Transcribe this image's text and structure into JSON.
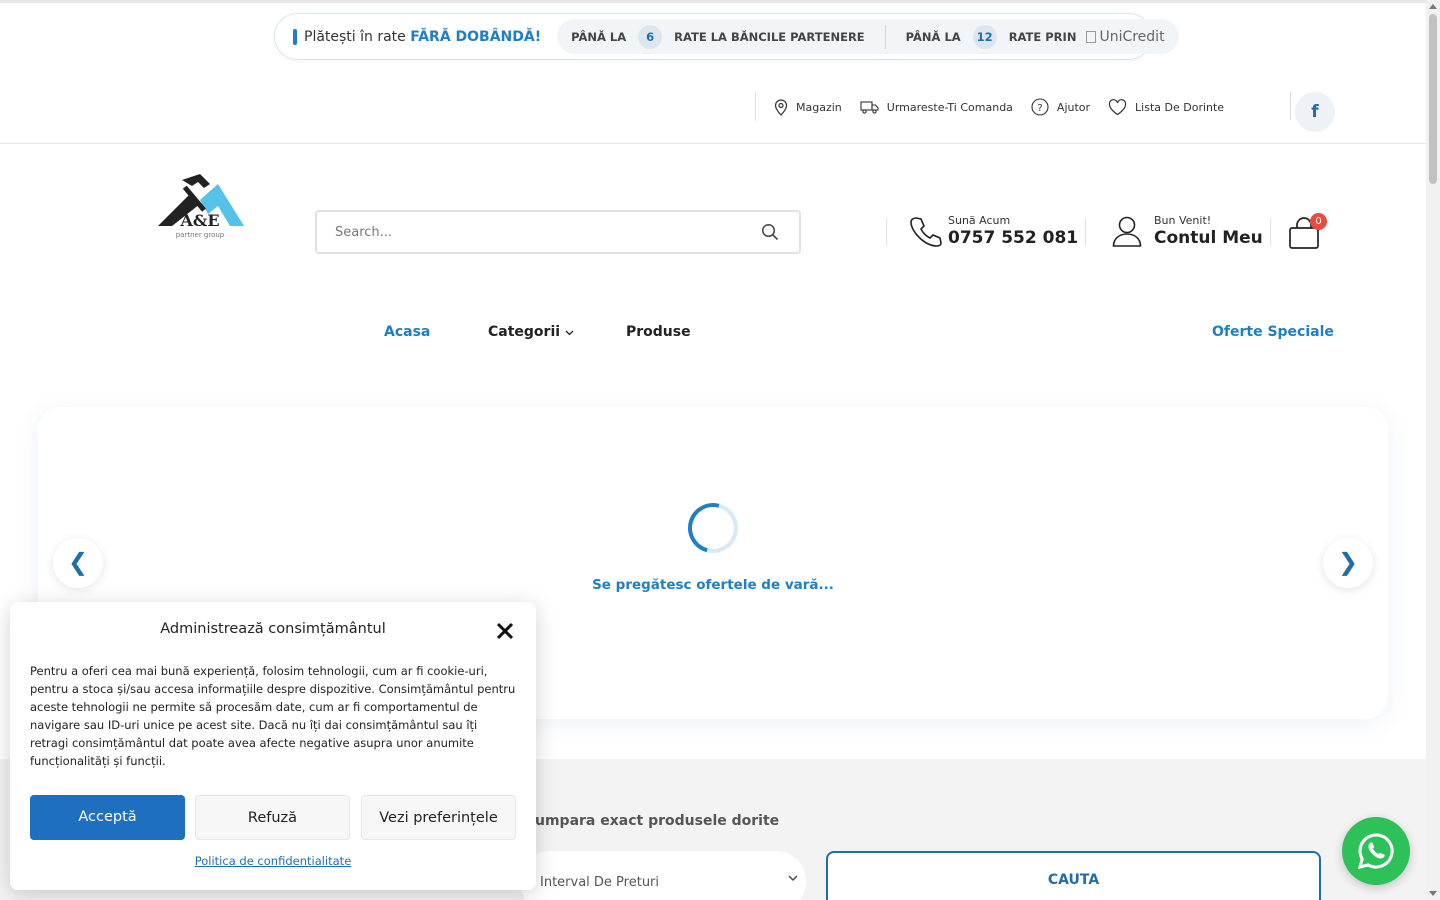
{
  "promo": {
    "lead_text": "Plătești în rate ",
    "lead_highlight": "FĂRĂ DOBÂNDĂ!",
    "pill1_prefix": "PÂNĂ LA",
    "pill1_number": "6",
    "pill1_suffix": "RATE LA BĂNCILE PARTENERE",
    "pill2_prefix": "PÂNĂ LA",
    "pill2_number": "12",
    "pill2_suffix": "RATE PRIN",
    "bank_alt": "UniCredit"
  },
  "toplinks": {
    "store": "Magazin",
    "track": "Urmareste-Ti Comanda",
    "help": "Ajutor",
    "wishlist": "Lista De Dorinte",
    "facebook": "f"
  },
  "header": {
    "logo_text": "A&E",
    "logo_sub": "partner group",
    "search_placeholder": "Search...",
    "call_label": "Sună Acum",
    "call_number": "0757 552 081",
    "account_label": "Bun Venit!",
    "account_name": "Contul Meu",
    "cart_count": "0"
  },
  "nav": {
    "home": "Acasa",
    "categories": "Categorii",
    "products": "Produse",
    "offers": "Oferte Speciale"
  },
  "slider": {
    "loading_text": "Se pregătesc ofertele de vară...",
    "prev": "❮",
    "next": "❯"
  },
  "filter": {
    "hint": "umpara exact produsele dorite",
    "price_range": "Interval De Preturi",
    "search_button": "CAUTA"
  },
  "consent": {
    "title": "Administrează consimțământul",
    "body": "Pentru a oferi cea mai bună experiență, folosim tehnologii, cum ar fi cookie-uri, pentru a stoca și/sau accesa informațiile despre dispozitive. Consimțământul pentru aceste tehnologii ne permite să procesăm date, cum ar fi comportamentul de navigare sau ID-uri unice pe acest site. Dacă nu îți dai consimțământul sau îți retragi consimțământul dat poate avea afecte negative asupra unor anumite funcționalități și funcții.",
    "accept": "Acceptă",
    "refuse": "Refuză",
    "preferences": "Vezi preferințele",
    "policy": "Politica de confidentialitate"
  },
  "colors": {
    "accent": "#1e7fc4",
    "consent_button": "#1e6fc0",
    "whatsapp": "#2ec15a",
    "badge": "#e74c3c"
  },
  "icons": {
    "promo": "credit-card-icon",
    "store": "map-pin-icon",
    "track": "truck-icon",
    "help": "question-circle-icon",
    "wishlist": "heart-icon",
    "search": "search-icon",
    "call": "phone-icon",
    "account": "user-icon",
    "cart": "shopping-bag-icon",
    "close": "close-icon",
    "whatsapp": "whatsapp-icon"
  }
}
